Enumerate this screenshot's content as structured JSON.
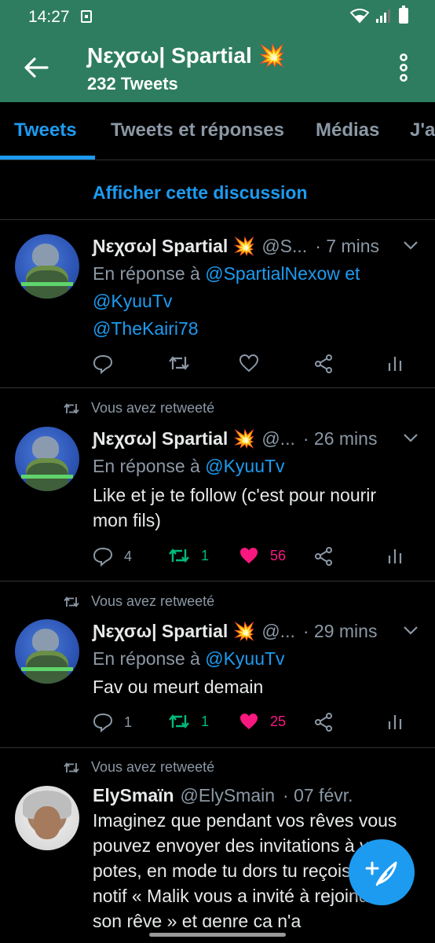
{
  "statusbar": {
    "time": "14:27"
  },
  "appbar": {
    "title": "Ɲεχσω| Spartial 💥",
    "subtitle": "232 Tweets"
  },
  "tabs": [
    {
      "label": "Tweets"
    },
    {
      "label": "Tweets et réponses"
    },
    {
      "label": "Médias"
    },
    {
      "label": "J'a"
    }
  ],
  "show_thread": "Afficher cette discussion",
  "tweets": [
    {
      "retweet_label": "",
      "name": "Ɲεχσω| Spartial 💥",
      "handle": "@S...",
      "time": "· 7 mins",
      "reply_prefix": "En réponse à",
      "reply_to_line1": "@SpartialNexow et",
      "reply_to_line2": "@KyuuTv",
      "body": "@TheKairi78",
      "replies": "",
      "retweets": "",
      "likes": ""
    },
    {
      "retweet_label": "Vous avez retweeté",
      "name": "Ɲεχσω| Spartial 💥",
      "handle": "@...",
      "time": "· 26 mins",
      "reply_prefix": "En réponse à",
      "reply_to_line1": "@KyuuTv",
      "body": "Like et je te follow (c'est pour nourir mon fils)",
      "replies": "4",
      "retweets": "1",
      "likes": "56"
    },
    {
      "retweet_label": "Vous avez retweeté",
      "name": "Ɲεχσω| Spartial 💥",
      "handle": "@...",
      "time": "· 29 mins",
      "reply_prefix": "En réponse à",
      "reply_to_line1": "@KyuuTv",
      "body": "Fav ou meurt demain",
      "replies": "1",
      "retweets": "1",
      "likes": "25"
    },
    {
      "retweet_label": "Vous avez retweeté",
      "name": "ElySmaïn",
      "handle": "@ElySmain",
      "time": "· 07 févr.",
      "body": "Imaginez que pendant vos rêves vous pouvez envoyer des invitations à vos potes, en mode tu dors tu reçois une notif « Malik vous a invité à rejoindre son rêve » et genre ça n'a"
    }
  ],
  "colors": {
    "header": "#2e7d60",
    "accent": "#1d9bf0",
    "retweet": "#00ba7c",
    "like": "#f91880"
  }
}
